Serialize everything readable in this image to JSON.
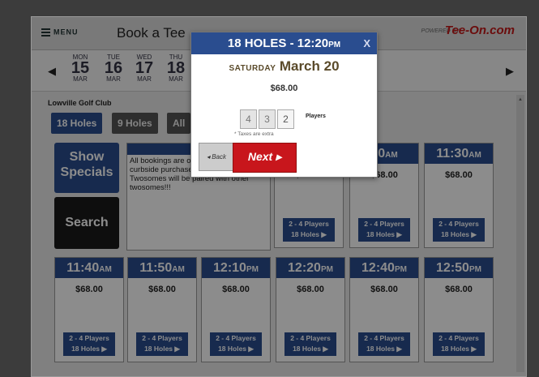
{
  "header": {
    "menu_label": "MENU",
    "title": "Book a Tee",
    "powered": "POWERED BY",
    "brand": "Tee-On.com"
  },
  "dates": [
    {
      "dow": "MON",
      "day": "15",
      "mon": "MAR"
    },
    {
      "dow": "TUE",
      "day": "16",
      "mon": "MAR"
    },
    {
      "dow": "WED",
      "day": "17",
      "mon": "MAR"
    },
    {
      "dow": "THU",
      "day": "18",
      "mon": "MAR"
    }
  ],
  "course": "Lowville Golf Club",
  "filters": [
    "18 Holes",
    "9 Holes",
    "All"
  ],
  "side_buttons": {
    "specials": "Show Specials",
    "search": "Search"
  },
  "notice": {
    "heading": "N",
    "body": "All bookings are only!!! Carts will curbside purchase by debit or credit...... Twosomes will be paired with other twosomes!!!"
  },
  "top_cards": [
    {
      "time": "10",
      "ampm": "AM",
      "price": "$68.00",
      "players": "2 - 4 Players",
      "holes": "18 Holes ▶"
    },
    {
      "time": "10",
      "ampm": "AM",
      "price": "$68.00",
      "players": "2 - 4 Players",
      "holes": "18 Holes ▶"
    },
    {
      "time": "11:30",
      "ampm": "AM",
      "price": "$68.00",
      "players": "2 - 4 Players",
      "holes": "18 Holes ▶"
    }
  ],
  "cards": [
    {
      "time": "11:40",
      "ampm": "AM",
      "price": "$68.00",
      "players": "2 - 4 Players",
      "holes": "18 Holes ▶"
    },
    {
      "time": "11:50",
      "ampm": "AM",
      "price": "$68.00",
      "players": "2 - 4 Players",
      "holes": "18 Holes ▶"
    },
    {
      "time": "12:10",
      "ampm": "PM",
      "price": "$68.00",
      "players": "2 - 4 Players",
      "holes": "18 Holes ▶"
    },
    {
      "time": "12:20",
      "ampm": "PM",
      "price": "$68.00",
      "players": "2 - 4 Players",
      "holes": "18 Holes ▶"
    },
    {
      "time": "12:40",
      "ampm": "PM",
      "price": "$68.00",
      "players": "2 - 4 Players",
      "holes": "18 Holes ▶"
    },
    {
      "time": "12:50",
      "ampm": "PM",
      "price": "$68.00",
      "players": "2 - 4 Players",
      "holes": "18 Holes ▶"
    }
  ],
  "modal": {
    "title": "18 HOLES - 12:20",
    "ampm": "PM",
    "close": "X",
    "weekday": "SATURDAY",
    "date": "March 20",
    "price": "$68.00",
    "player_options": [
      "4",
      "3",
      "2"
    ],
    "players_label": "Players",
    "tax_note": "* Taxes are extra",
    "back_label": "◂ Back",
    "next_label": "Next ▸"
  },
  "colors": {
    "brand_blue": "#2a4d8f",
    "next_red": "#c8161c"
  }
}
